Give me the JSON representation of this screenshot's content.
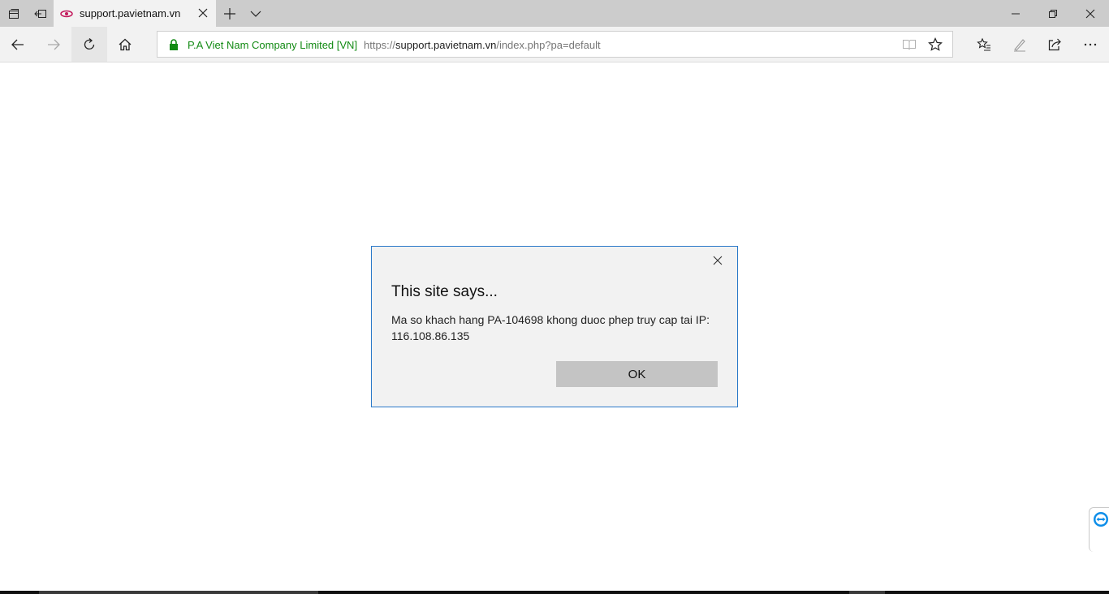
{
  "tabs": [
    {
      "title": "support.pavietnam.vn",
      "active": true
    }
  ],
  "address": {
    "site_identity": "P.A Viet Nam Company Limited [VN]",
    "url_scheme": "https://",
    "url_host": "support.pavietnam.vn",
    "url_path": "/index.php?pa=default"
  },
  "dialog": {
    "title": "This site says...",
    "message": "Ma so khach hang PA-104698 khong duoc phep truy cap tai IP: 116.108.86.135",
    "ok_label": "OK"
  },
  "colors": {
    "tabbar": "#cccccc",
    "navbar": "#f2f2f2",
    "secure_green": "#128a13",
    "dialog_border": "#2b79c9",
    "remote_widget_blue": "#0e8ee9"
  },
  "icons": {
    "tab_actions": [
      "tabs-aside-icon",
      "restore-tabs-icon"
    ],
    "window_controls": [
      "minimize-icon",
      "maximize-icon",
      "close-icon"
    ],
    "nav": [
      "back-arrow-icon",
      "forward-arrow-icon",
      "refresh-icon",
      "home-icon"
    ],
    "toolbar": [
      "favorites-icon",
      "notes-pen-icon",
      "share-icon",
      "more-icon"
    ]
  }
}
